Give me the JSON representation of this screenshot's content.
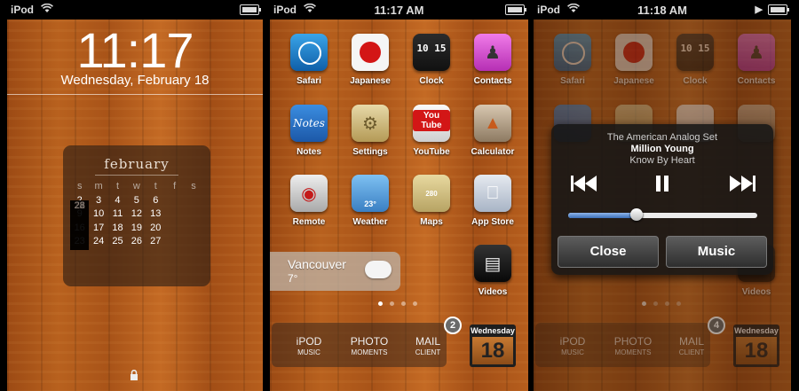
{
  "screens": {
    "lock": {
      "status": {
        "carrier": "iPod",
        "wifi_icon": "wifi-icon"
      },
      "time": "11:17",
      "date": "Wednesday, February 18",
      "calendar": {
        "month": "february",
        "weekdays": [
          "s",
          "m",
          "t",
          "w",
          "t",
          "f",
          "s"
        ],
        "weeks": [
          [
            "1",
            "2",
            "3",
            "4",
            "5",
            "6",
            "7"
          ],
          [
            "8",
            "9",
            "10",
            "11",
            "12",
            "13",
            "14"
          ],
          [
            "15",
            "16",
            "17",
            "18",
            "19",
            "20",
            "21"
          ],
          [
            "22",
            "23",
            "24",
            "25",
            "26",
            "27",
            "28"
          ]
        ]
      },
      "lock_icon": "lock-icon"
    },
    "home": {
      "status": {
        "carrier": "iPod",
        "time": "11:17 AM"
      },
      "apps": [
        {
          "label": "Safari",
          "icon": "safari-icon"
        },
        {
          "label": "Japanese",
          "icon": "japanese-icon"
        },
        {
          "label": "Clock",
          "icon": "clock-icon",
          "digits": "10 15"
        },
        {
          "label": "Contacts",
          "icon": "contacts-icon"
        },
        {
          "label": "Notes",
          "icon": "notes-icon",
          "glyph": "Notes"
        },
        {
          "label": "Settings",
          "icon": "settings-icon"
        },
        {
          "label": "YouTube",
          "icon": "youtube-icon",
          "glyph": "You Tube"
        },
        {
          "label": "Calculator",
          "icon": "calculator-icon"
        },
        {
          "label": "Remote",
          "icon": "remote-icon"
        },
        {
          "label": "Weather",
          "icon": "weather-icon",
          "glyph": "23°"
        },
        {
          "label": "Maps",
          "icon": "maps-icon",
          "glyph": "280"
        },
        {
          "label": "App Store",
          "icon": "app-store-icon"
        },
        {
          "label": "Videos",
          "icon": "videos-icon"
        }
      ],
      "widget": {
        "city": "Vancouver",
        "temp": "7°"
      },
      "dock": [
        {
          "big": "iPOD",
          "small": "MUSIC"
        },
        {
          "big": "PHOTO",
          "small": "MOMENTS"
        },
        {
          "big": "MAIL",
          "small": "CLIENT"
        }
      ],
      "badge": "2",
      "date_widget": {
        "weekday": "Wednesday",
        "day": "18"
      }
    },
    "music": {
      "status": {
        "carrier": "iPod",
        "time": "11:18 AM"
      },
      "popup": {
        "line1": "The American Analog Set",
        "line2": "Million Young",
        "line3": "Know By Heart",
        "progress_pct": 36,
        "close_label": "Close",
        "music_label": "Music"
      },
      "badge": "4",
      "date_widget": {
        "weekday": "Wednesday",
        "day": "18"
      }
    }
  }
}
